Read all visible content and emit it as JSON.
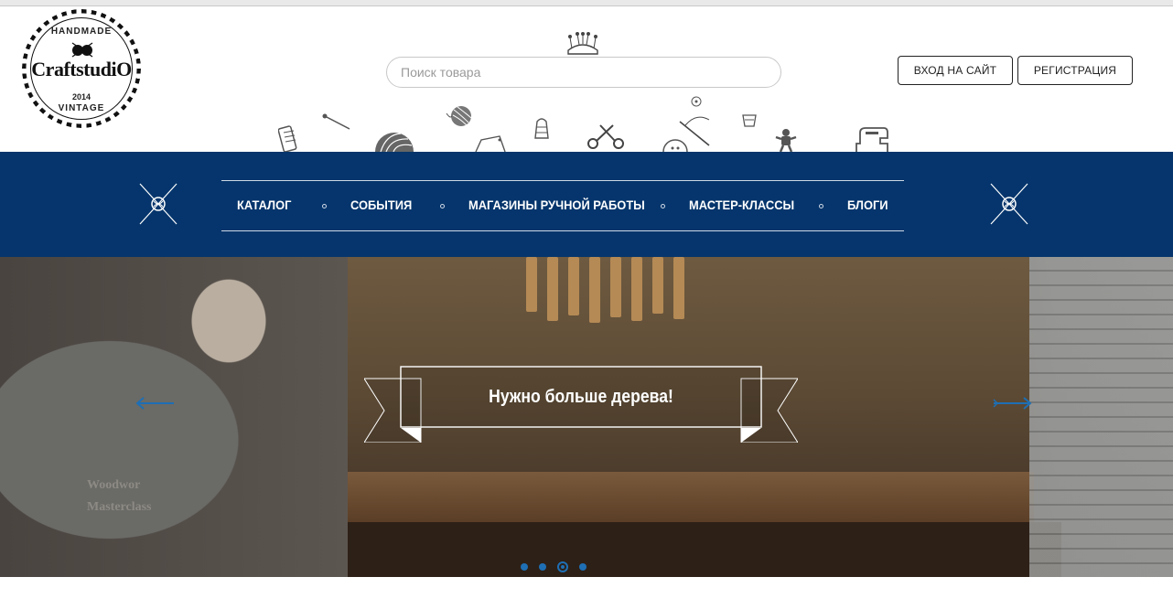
{
  "logo": {
    "top_word": "HANDMADE",
    "name": "CraftstudiO",
    "year": "2014",
    "bottom_word": "VINTAGE"
  },
  "search": {
    "placeholder": "Поиск товара"
  },
  "auth": {
    "login_label": "ВХОД НА САЙТ",
    "register_label": "РЕГИСТРАЦИЯ"
  },
  "nav": {
    "items": [
      {
        "label": "КАТАЛОГ"
      },
      {
        "label": "СОБЫТИЯ"
      },
      {
        "label": "МАГАЗИНЫ РУЧНОЙ РАБОТЫ"
      },
      {
        "label": "МАСТЕР-КЛАССЫ"
      },
      {
        "label": "БЛОГИ"
      }
    ]
  },
  "hero": {
    "title": "Нужно больше дерева!",
    "apron_line1": "Woodwor",
    "apron_line2": "Masterclass",
    "slides_total": 4,
    "active_slide": 3
  },
  "colors": {
    "nav_bg": "#05356c",
    "accent": "#1e6fb4"
  },
  "icons": [
    "yarn-icon",
    "pin-cushion-icon",
    "spool-icon",
    "needle-icon",
    "yarn-ball-icon",
    "thimble-icon",
    "scissors-icon",
    "button-icon",
    "needle-thread-icon",
    "gingerbread-icon",
    "sewing-machine-icon",
    "knitting-needles-icon",
    "arrow-left-icon",
    "arrow-right-icon"
  ]
}
